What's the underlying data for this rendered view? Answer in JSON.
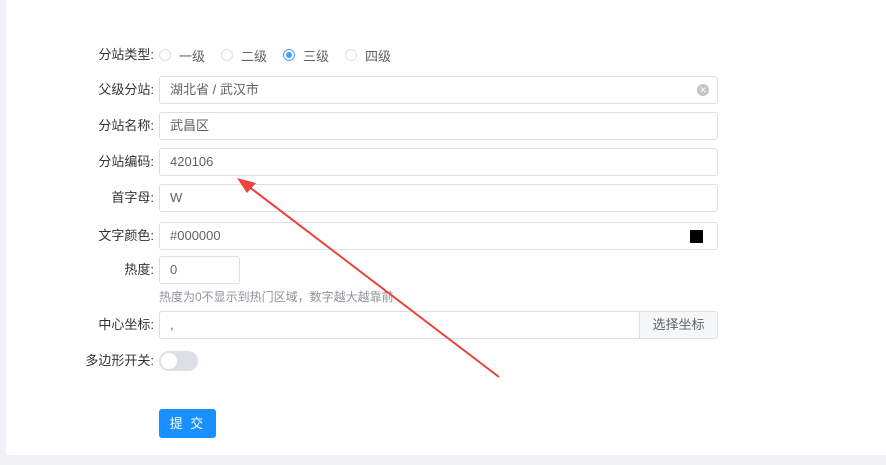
{
  "form": {
    "type": {
      "label": "分站类型:",
      "options": [
        "一级",
        "二级",
        "三级",
        "四级"
      ],
      "selected": "三级"
    },
    "parent": {
      "label": "父级分站:",
      "value": "湖北省 / 武汉市"
    },
    "name": {
      "label": "分站名称:",
      "value": "武昌区"
    },
    "code": {
      "label": "分站编码:",
      "value": "420106"
    },
    "initial": {
      "label": "首字母:",
      "value": "W"
    },
    "color": {
      "label": "文字颜色:",
      "value": "#000000",
      "swatch": "#000000"
    },
    "heat": {
      "label": "热度:",
      "value": "0",
      "hint": "热度为0不显示到热门区域，数字越大越靠前"
    },
    "center": {
      "label": "中心坐标:",
      "value": ",",
      "button": "选择坐标"
    },
    "polygon": {
      "label": "多边形开关:",
      "enabled": false
    },
    "submit": "提 交"
  },
  "annotation": {
    "arrow_color": "#e8443a"
  }
}
